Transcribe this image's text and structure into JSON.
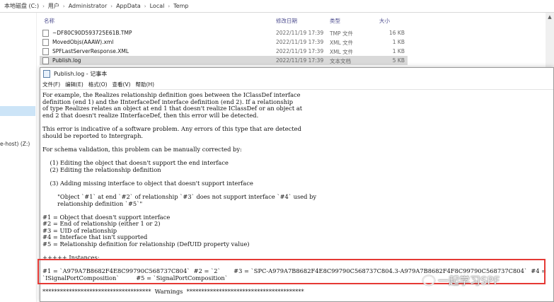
{
  "explorer": {
    "breadcrumb": [
      "本地磁盘 (C:)",
      "用户",
      "Administrator",
      "AppData",
      "Local",
      "Temp"
    ],
    "columns": {
      "name": "名称",
      "date": "修改日期",
      "type": "类型",
      "size": "大小"
    },
    "files": [
      {
        "name": "~DF80C90D593725E61B.TMP",
        "date": "2022/11/19 17:39",
        "type": "TMP 文件",
        "size": "16 KB"
      },
      {
        "name": "MovedObjs(AAAW).xml",
        "date": "2022/11/19 17:39",
        "type": "XML 文件",
        "size": "1 KB"
      },
      {
        "name": "SPFLastServerResponse.XML",
        "date": "2022/11/19 17:39",
        "type": "XML 文件",
        "size": "1 KB"
      },
      {
        "name": "Publish.log",
        "date": "2022/11/19 17:39",
        "type": "文本文档",
        "size": "5 KB"
      }
    ],
    "nav_drive": "e-host) (Z:)"
  },
  "notepad": {
    "title": "Publish.log - 记事本",
    "menu": [
      "文件(F)",
      "编辑(E)",
      "格式(O)",
      "查看(V)",
      "帮助(H)"
    ],
    "lines": [
      "For example, the Realizes relationship definition goes between the IClassDef interface",
      "definition (end 1) and the IInterfaceDef interface definition (end 2). If a relationship",
      "of type Realizes relates an object at end 1 that doesn't realize IClassDef or an object at",
      "end 2 that doesn't realize IInterfaceDef, then this error will be detected.",
      "",
      "This error is indicative of a software problem. Any errors of this type that are detected",
      "should be reported to Intergraph.",
      "",
      "For schema validation, this problem can be manually corrected by:",
      "",
      "    (1) Editing the object that doesn't support the end interface",
      "    (2) Editing the relationship definition",
      "",
      "    (3) Adding missing interface to object that doesn't support interface",
      "",
      "        \"Object `#1` at end `#2` of relationship `#3` does not support interface `#4` used by",
      "        relationship definition `#5`\"",
      "",
      "#1 = Object that doesn't support interface",
      "#2 = End of relationship (either 1 or 2)",
      "#3 = UID of relationship",
      "#4 = Interface that isn't supported",
      "#5 = Relationship definition for relationship (DefUID property value)",
      "",
      "+++++ Instances:",
      "",
      "#1 = `A979A7B8682F4E8C99790C568737C804`  #2 = `2`       #3 = `SPC-A979A7B8682F4E8C99790C568737C804.3-A979A7B8682F4F8C99790C568737C804`  #4 =",
      "`ISignalPortComposition`         #5 = `SignalPortComposition`",
      "",
      "*************************************  Warnings  ****************************************"
    ]
  },
  "watermark": "一起学习SPF"
}
